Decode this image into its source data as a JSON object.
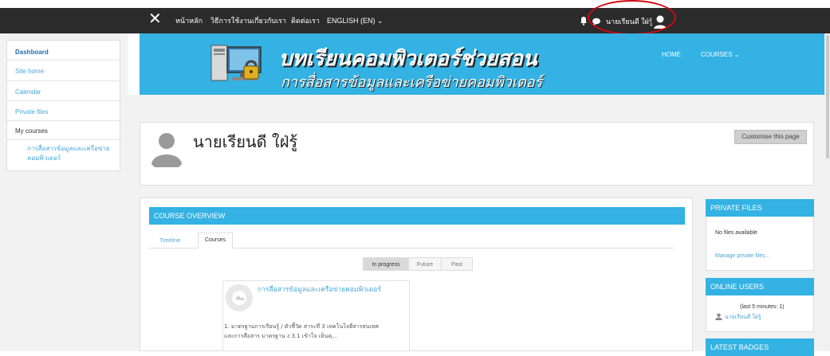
{
  "topnav": {
    "close_glyph": "✕",
    "links": [
      "หน้าหลัก",
      "วิธีการใช้งาน",
      "เกี่ยวกับเรา",
      "ติดต่อเรา",
      "ENGLISH (EN) ⌄"
    ],
    "user_name": "นายเรียนดี ใฝ่รู้",
    "icons": [
      "bell-icon",
      "chat-icon",
      "user-avatar-icon"
    ]
  },
  "sidebar": {
    "items": [
      {
        "label": "Dashboard"
      },
      {
        "label": "Site home"
      },
      {
        "label": "Calendar"
      },
      {
        "label": "Private files"
      },
      {
        "label": "My courses"
      }
    ],
    "sub_course": "การสื่อสารข้อมูลและเครือข่าย คอมพิวเตอร์"
  },
  "banner": {
    "title_line1": "บทเรียนคอมพิวเตอร์ช่วยสอน",
    "title_line2": "การสื่อสารข้อมูลและเครือข่ายคอมพิวเตอร์",
    "home": "HOME",
    "courses": "COURSES ⌄"
  },
  "profile": {
    "name": "นายเรียนดี ใฝ่รู้",
    "customise_button": "Customise this page"
  },
  "course_overview": {
    "header": "COURSE OVERVIEW",
    "tabs": [
      "Timeline",
      "Courses"
    ],
    "segments": [
      "In progress",
      "Future",
      "Past"
    ],
    "course": {
      "title": "การสื่อสารข้อมูลและเครือข่ายคอมพิวเตอร์",
      "desc_line1": "1. มาตรฐานการเรียนรู้ / ตัวชี้วัด     สาระที่ 3 เทคโนโลยีสารสนเทศ",
      "desc_line2": "และการสื่อสาร                    มาตรฐาน ง 3.1 เข้าใจ เห็นคุ..."
    }
  },
  "private_files": {
    "header": "PRIVATE FILES",
    "empty": "No files available",
    "manage_link": "Manage private files..."
  },
  "online_users": {
    "header": "ONLINE USERS",
    "summary": "(last 5 minutes: 1)",
    "user": "นายเรียนดี ใฝ่รู้"
  },
  "latest_badges": {
    "header": "LATEST BADGES"
  },
  "colors": {
    "accent": "#33b2e3",
    "navbar": "#2b2b2b",
    "annotation": "#d10a13"
  }
}
